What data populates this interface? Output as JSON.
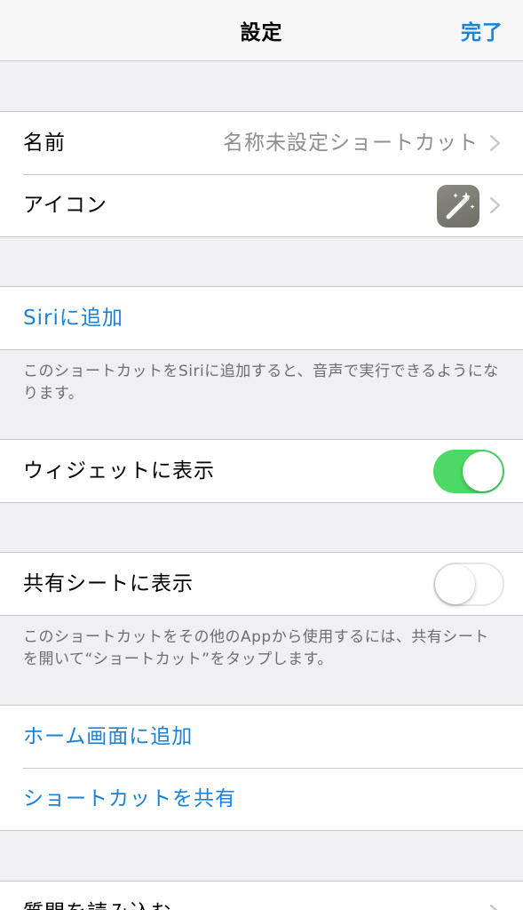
{
  "nav": {
    "title": "設定",
    "done_label": "完了",
    "accent_color": "#1a82d6"
  },
  "general": {
    "name_label": "名前",
    "name_value": "名称未設定ショートカット",
    "icon_label": "アイコン",
    "icon_glyph": "magic-wand-icon",
    "icon_color": "#7d7d74"
  },
  "siri": {
    "add_label": "Siriに追加",
    "footnote": "このショートカットをSiriに追加すると、音声で実行できるようになります。"
  },
  "widget": {
    "label": "ウィジェットに表示",
    "enabled": true,
    "toggle_color": "#4cd964"
  },
  "share_sheet": {
    "label": "共有シートに表示",
    "enabled": false,
    "footnote": "このショートカットをその他のAppから使用するには、共有シートを開いて“ショートカット”をタップします。"
  },
  "actions": {
    "add_home_label": "ホーム画面に追加",
    "share_label": "ショートカットを共有"
  },
  "import": {
    "label": "質問を読み込む"
  }
}
